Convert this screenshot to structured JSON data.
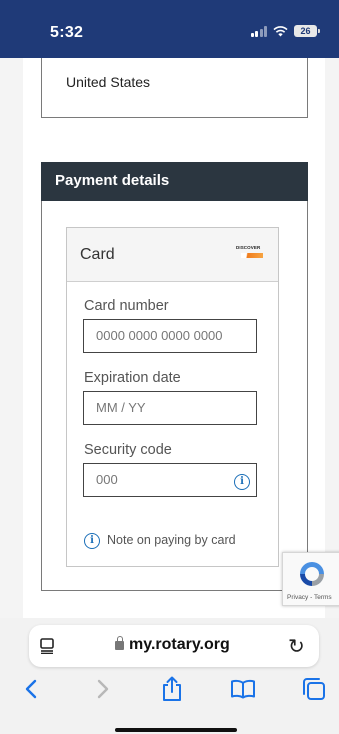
{
  "status_bar": {
    "time": "5:32",
    "battery": "26"
  },
  "address": {
    "country": "United States"
  },
  "payment": {
    "title": "Payment details",
    "card_header": "Card",
    "card_brand": "DISCOVER",
    "card_number_label": "Card number",
    "card_number_placeholder": "0000 0000 0000 0000",
    "expiration_label": "Expiration date",
    "expiration_placeholder": "MM / YY",
    "security_label": "Security code",
    "security_placeholder": "000",
    "note": "Note on paying by card"
  },
  "recaptcha": {
    "text": "Privacy - Terms"
  },
  "browser": {
    "url": "my.rotary.org"
  },
  "colors": {
    "status_bar": "#1f3a78",
    "payment_header": "#2b3640",
    "link_blue": "#1b6fb8"
  }
}
